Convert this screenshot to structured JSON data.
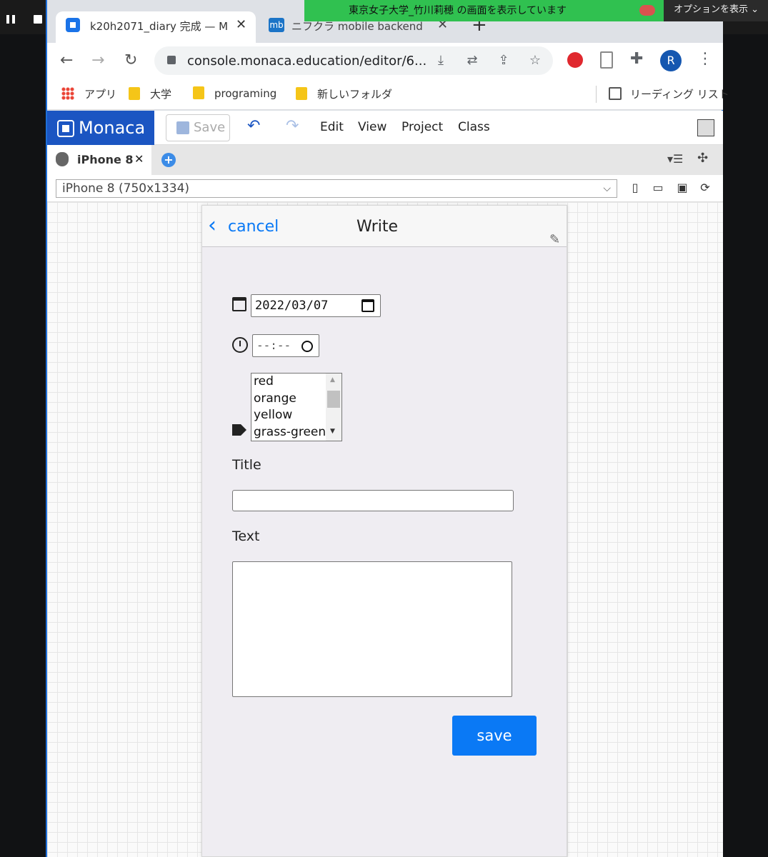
{
  "recording": {
    "share_banner": "東京女子大学_竹川莉穂 の画面を表示しています",
    "options_label": "オプションを表示"
  },
  "browser": {
    "tabs": [
      {
        "label": "k20h2071_diary 完成 — M",
        "icon": "monaca-icon"
      },
      {
        "label": "ニフクラ mobile backend",
        "icon": "mb-icon",
        "icon_text": "mb"
      }
    ],
    "url": "console.monaca.education/editor/6...",
    "profile_initial": "R",
    "bookmarks": [
      {
        "label": "アプリ",
        "type": "apps"
      },
      {
        "label": "大学",
        "type": "folder"
      },
      {
        "label": "programing",
        "type": "folder"
      },
      {
        "label": "新しいフォルダ",
        "type": "folder"
      }
    ],
    "reading_list": "リーディング リスト"
  },
  "monaca": {
    "logo": "Monaca",
    "save_label": "Save",
    "menu": [
      "Edit",
      "View",
      "Project",
      "Class"
    ],
    "preview_tab": "iPhone 8",
    "device_select": "iPhone 8 (750x1334)"
  },
  "app": {
    "cancel_label": "cancel",
    "title": "Write",
    "date_value": "2022/03/07",
    "time_value": "--:--",
    "color_options": [
      "red",
      "orange",
      "yellow",
      "grass-green"
    ],
    "title_label": "Title",
    "text_label": "Text",
    "save_label": "save",
    "accent_color": "#0a79f5"
  }
}
